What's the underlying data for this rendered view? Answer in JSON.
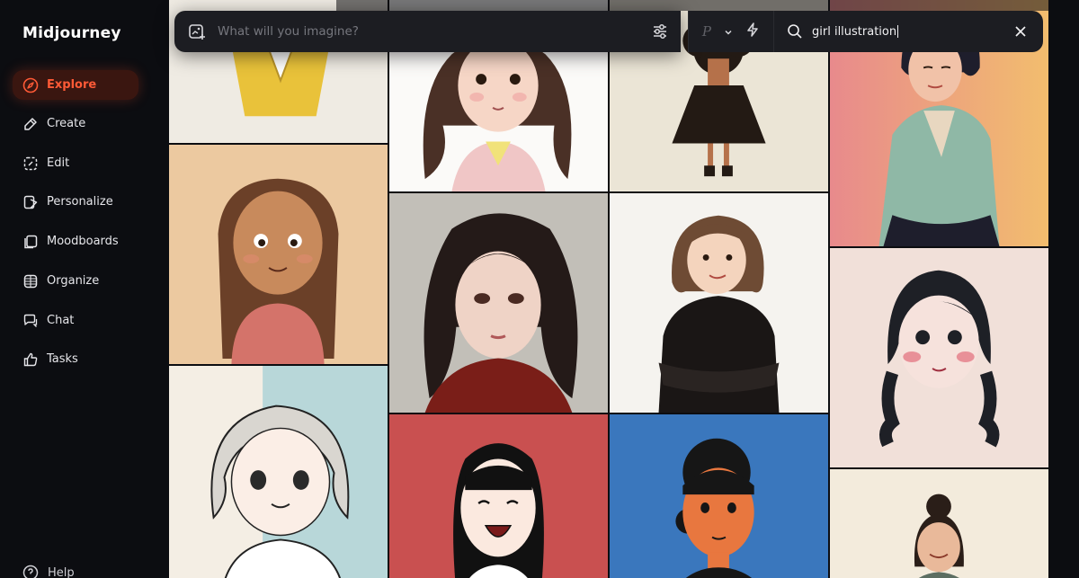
{
  "app": {
    "title": "Midjourney"
  },
  "sidebar": {
    "items": [
      {
        "label": "Explore",
        "icon": "compass-icon",
        "active": true
      },
      {
        "label": "Create",
        "icon": "brush-icon"
      },
      {
        "label": "Edit",
        "icon": "edit-frame-icon"
      },
      {
        "label": "Personalize",
        "icon": "personalize-icon"
      },
      {
        "label": "Moodboards",
        "icon": "moodboard-icon"
      },
      {
        "label": "Organize",
        "icon": "grid-icon"
      },
      {
        "label": "Chat",
        "icon": "chat-icon"
      },
      {
        "label": "Tasks",
        "icon": "thumbs-up-icon"
      }
    ],
    "help_label": "Help"
  },
  "prompt": {
    "placeholder": "What will you imagine?"
  },
  "mode": {
    "personalize_glyph": "P"
  },
  "search": {
    "query": "girl illustration"
  },
  "colors": {
    "accent": "#ff5a36",
    "active_bg": "#3a1610",
    "bar_bg": "#1c1d22"
  }
}
